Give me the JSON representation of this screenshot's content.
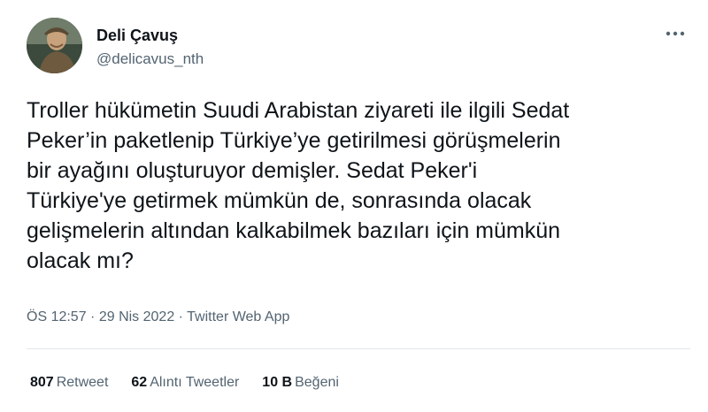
{
  "author": {
    "display_name": "Deli Çavuş",
    "handle": "@delicavus_nth"
  },
  "tweet": {
    "text": "Troller hükümetin Suudi Arabistan ziyareti ile ilgili Sedat\nPeker’in paketlenip Türkiye’ye getirilmesi görüşmelerin\nbir ayağını oluşturuyor demişler. Sedat Peker'i\nTürkiye'ye getirmek mümkün de, sonrasında olacak\ngelişmelerin altından kalkabilmek bazıları için mümkün\nolacak mı?"
  },
  "meta": {
    "time": "ÖS 12:57",
    "separator": " · ",
    "date": "29 Nis 2022",
    "source": "Twitter Web App"
  },
  "stats": {
    "retweets_count": "807",
    "retweets_label": "Retweet",
    "quotes_count": "62",
    "quotes_label": "Alıntı Tweetler",
    "likes_count": "10 B",
    "likes_label": "Beğeni"
  },
  "icons": {
    "more": "more-horizontal-icon"
  }
}
